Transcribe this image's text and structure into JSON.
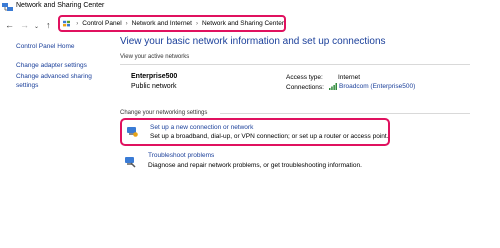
{
  "window": {
    "title": "Network and Sharing Center",
    "icon": "network-sharing-icon"
  },
  "nav": {
    "back": "←",
    "forward": "→",
    "recent": "⌄",
    "up": "↑"
  },
  "address": {
    "icon": "control-panel-icon",
    "separator": "›",
    "crumbs": [
      "Control Panel",
      "Network and Internet",
      "Network and Sharing Center"
    ]
  },
  "sidebar": {
    "home": "Control Panel Home",
    "adapter": "Change adapter settings",
    "advanced": "Change advanced sharing settings"
  },
  "main": {
    "heading": "View your basic network information and set up connections",
    "active_label": "View your active networks",
    "network": {
      "name": "Enterprise500",
      "type": "Public network",
      "access_key": "Access type:",
      "access_value": "Internet",
      "connections_key": "Connections:",
      "connections_value": "Broadcom (Enterprise500)",
      "connections_icon": "wifi-signal-icon"
    },
    "change_label": "Change your networking settings",
    "tasks": [
      {
        "title": "Set up a new connection or network",
        "desc": "Set up a broadband, dial-up, or VPN connection; or set up a router or access point.",
        "icon": "new-connection-icon"
      },
      {
        "title": "Troubleshoot problems",
        "desc": "Diagnose and repair network problems, or get troubleshooting information.",
        "icon": "troubleshoot-icon"
      }
    ]
  },
  "colors": {
    "link": "#1a3f9a",
    "highlight": "#e0115f"
  }
}
